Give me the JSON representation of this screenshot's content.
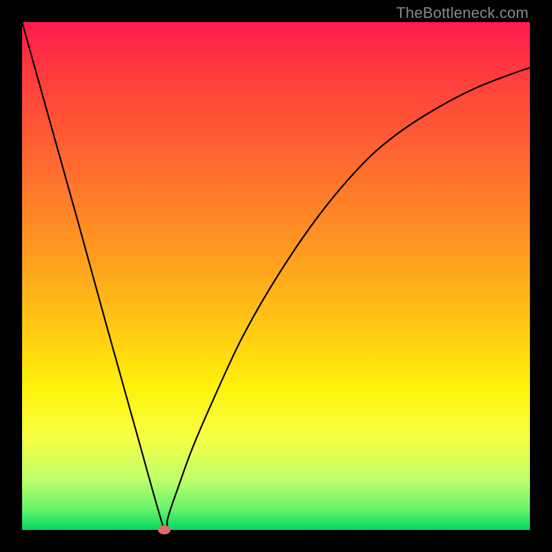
{
  "watermark": "TheBottleneck.com",
  "chart_data": {
    "type": "line",
    "title": "",
    "xlabel": "",
    "ylabel": "",
    "x_range": [
      0,
      100
    ],
    "y_range": [
      0,
      100
    ],
    "background_gradient": {
      "orientation": "vertical",
      "stops": [
        {
          "pct": 0,
          "color": "#ff1a4d"
        },
        {
          "pct": 10,
          "color": "#ff3b3d"
        },
        {
          "pct": 28,
          "color": "#ff6a2f"
        },
        {
          "pct": 45,
          "color": "#ff9a20"
        },
        {
          "pct": 60,
          "color": "#ffc813"
        },
        {
          "pct": 72,
          "color": "#fff20a"
        },
        {
          "pct": 82,
          "color": "#f7ff45"
        },
        {
          "pct": 90,
          "color": "#bfff6a"
        },
        {
          "pct": 96,
          "color": "#66f26a"
        },
        {
          "pct": 100,
          "color": "#00d860"
        }
      ]
    },
    "series": [
      {
        "name": "bottleneck-curve",
        "color": "#000000",
        "x": [
          0.0,
          5.6,
          11.2,
          16.7,
          22.3,
          28.0,
          28.6,
          29.2,
          30.6,
          33.5,
          37.8,
          43.4,
          50.3,
          58.5,
          67.0,
          73.9,
          81.6,
          89.3,
          97.0,
          100.0
        ],
        "y": [
          100.0,
          80.0,
          60.0,
          40.0,
          20.0,
          0.0,
          2.0,
          4.0,
          8.0,
          16.0,
          26.0,
          38.0,
          50.0,
          62.0,
          72.0,
          78.0,
          83.0,
          87.0,
          90.0,
          91.0
        ]
      }
    ],
    "minimum_marker": {
      "x": 28.0,
      "y": 0.0,
      "color": "#e26a6a"
    }
  }
}
